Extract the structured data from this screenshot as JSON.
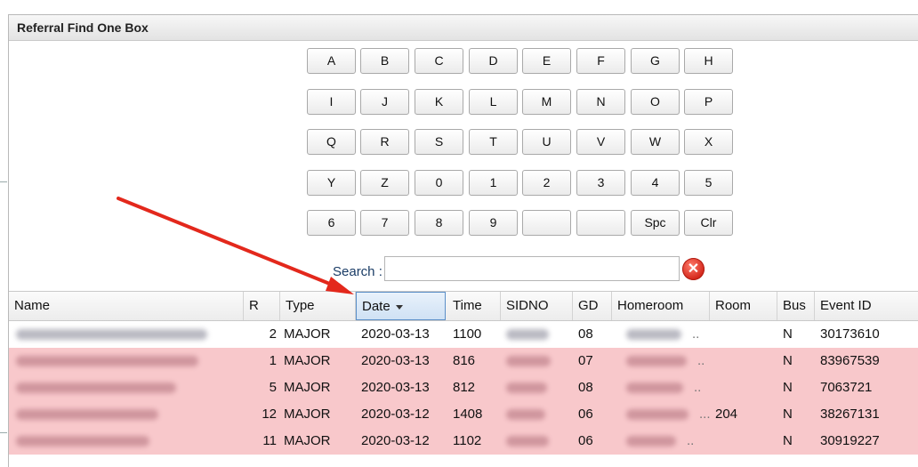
{
  "dialog": {
    "title": "Referral Find One Box"
  },
  "keypad": {
    "rows": [
      [
        "A",
        "B",
        "C",
        "D",
        "E",
        "F",
        "G",
        "H"
      ],
      [
        "I",
        "J",
        "K",
        "L",
        "M",
        "N",
        "O",
        "P"
      ],
      [
        "Q",
        "R",
        "S",
        "T",
        "U",
        "V",
        "W",
        "X"
      ],
      [
        "Y",
        "Z",
        "0",
        "1",
        "2",
        "3",
        "4",
        "5"
      ],
      [
        "6",
        "7",
        "8",
        "9",
        "",
        "",
        "Spc",
        "Clr"
      ]
    ]
  },
  "search": {
    "label": "Search :",
    "value": ""
  },
  "grid": {
    "columns": [
      "Name",
      "R",
      "Type",
      "Date",
      "Time",
      "SIDNO",
      "GD",
      "Homeroom",
      "Room",
      "Bus",
      "Event ID"
    ],
    "sorted_column": "Date",
    "rows": [
      {
        "r": "2",
        "type": "MAJOR",
        "date": "2020-03-13",
        "time": "1100",
        "gd": "08",
        "homeroom": "..",
        "room": "",
        "bus": "N",
        "event_id": "30173610",
        "highlight": false
      },
      {
        "r": "1",
        "type": "MAJOR",
        "date": "2020-03-13",
        "time": "816",
        "gd": "07",
        "homeroom": "..",
        "room": "",
        "bus": "N",
        "event_id": "83967539",
        "highlight": true
      },
      {
        "r": "5",
        "type": "MAJOR",
        "date": "2020-03-13",
        "time": "812",
        "gd": "08",
        "homeroom": "..",
        "room": "",
        "bus": "N",
        "event_id": "7063721",
        "highlight": true
      },
      {
        "r": "12",
        "type": "MAJOR",
        "date": "2020-03-12",
        "time": "1408",
        "gd": "06",
        "homeroom": "...",
        "room": "204",
        "bus": "N",
        "event_id": "38267131",
        "highlight": true
      },
      {
        "r": "11",
        "type": "MAJOR",
        "date": "2020-03-12",
        "time": "1102",
        "gd": "06",
        "homeroom": "..",
        "room": "",
        "bus": "N",
        "event_id": "30919227",
        "highlight": true
      }
    ]
  },
  "colors": {
    "row_highlight": "#f8c8cb",
    "annotation_arrow": "#e3281c",
    "sorted_header_border": "#5b8fc8"
  }
}
